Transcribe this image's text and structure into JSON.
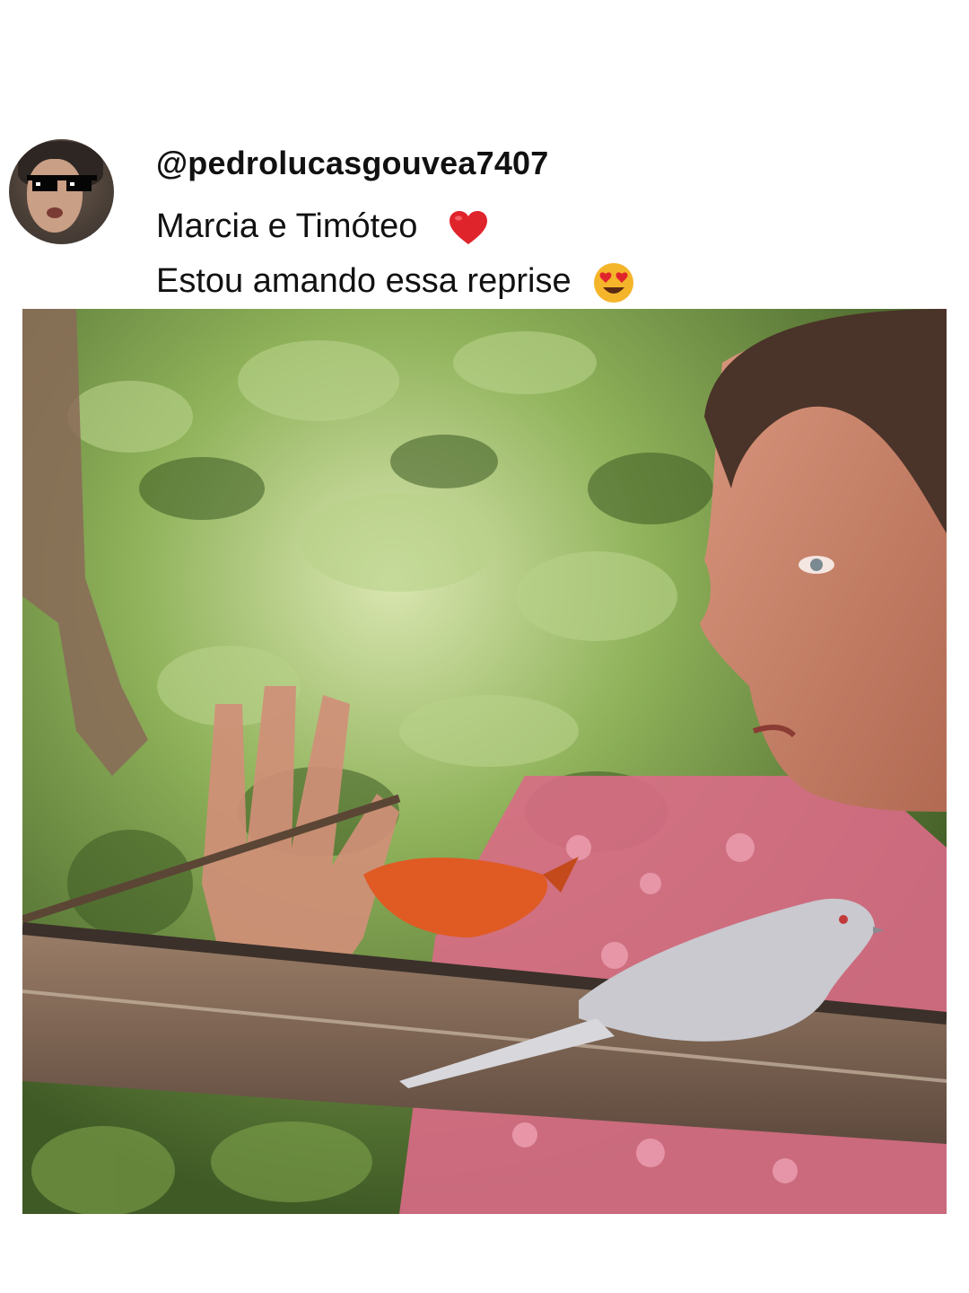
{
  "comment": {
    "username": "@pedrolucasgouvea7407",
    "lines": [
      {
        "text": "Marcia e Timóteo",
        "emoji": "red-heart-icon"
      },
      {
        "text": "Estou amando essa reprise",
        "emoji": "heart-eyes-face-icon"
      }
    ],
    "avatar_icon": "avatar-with-pixel-sunglasses"
  },
  "media": {
    "type": "video-frame",
    "description_icon": "video-still-woman-with-birds-on-branch"
  },
  "colors": {
    "background": "#ffffff",
    "text": "#111111",
    "heart": "#e0242c",
    "emoji_face": "#f5b52a"
  }
}
